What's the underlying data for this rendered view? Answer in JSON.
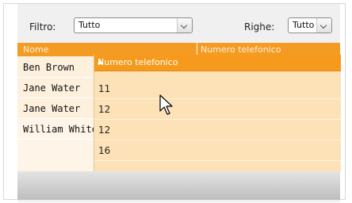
{
  "toolbar": {
    "filter_label": "Filtro:",
    "filter_value": "Tutto",
    "rows_label": "Righe:",
    "rows_value": "Tutto"
  },
  "grid": {
    "columns": [
      "Nome",
      "Numero telefonico"
    ],
    "rows": [
      {
        "name": "Ben Brown",
        "phone": "11"
      },
      {
        "name": "Jane Water",
        "phone": "12"
      },
      {
        "name": "Jane Water",
        "phone": "12"
      },
      {
        "name": "William White",
        "phone": "16"
      }
    ]
  },
  "drag_column": {
    "header": "Numero telefonico",
    "values": [
      "11",
      "12",
      "12",
      "16"
    ]
  },
  "colors": {
    "header_orange": "#f39b22",
    "row_background": "#fdf0dd",
    "drag_background": "#fde2b8"
  },
  "icons": {
    "cursor": "mouse-pointer-icon",
    "sort": "sort-ascending-icon",
    "dropdown": "chevron-down-icon"
  }
}
